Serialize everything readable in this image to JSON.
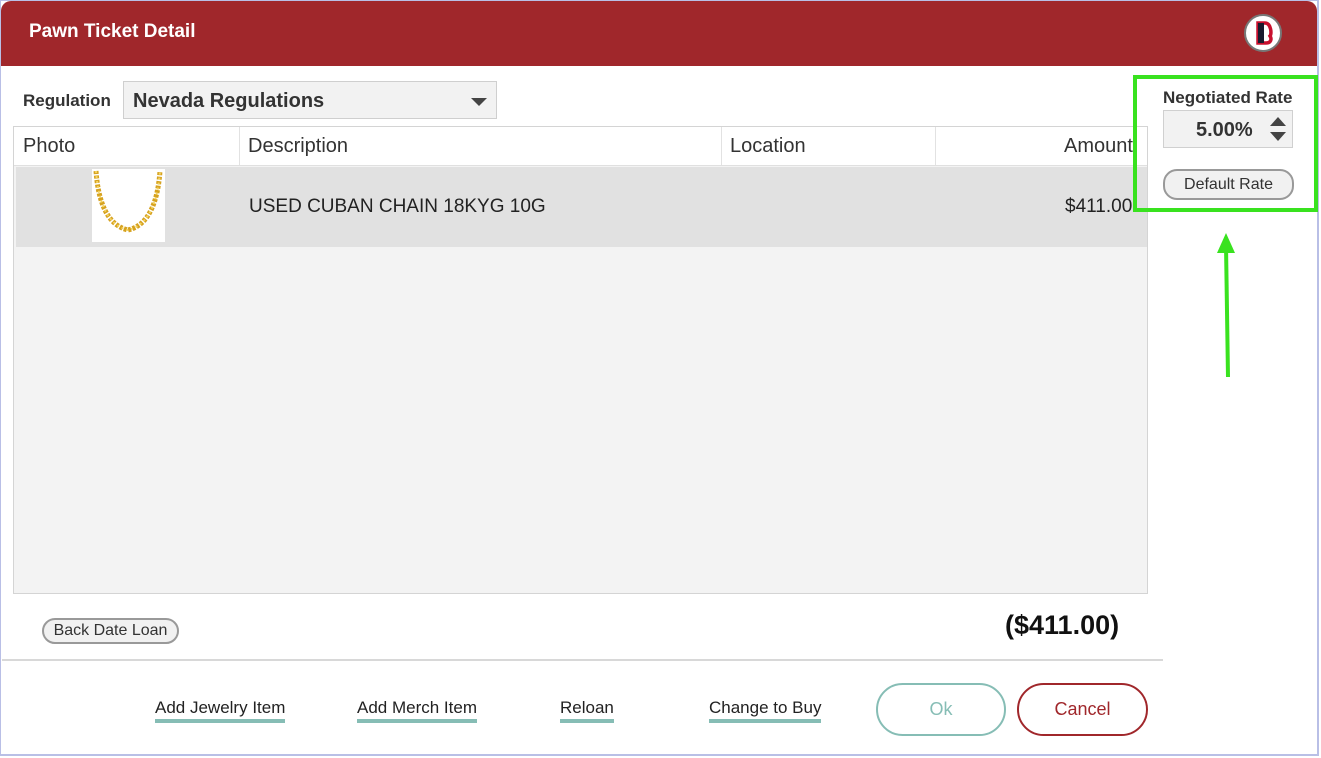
{
  "window": {
    "title": "Pawn Ticket Detail",
    "logo_icon": "brand-b-logo"
  },
  "regulation": {
    "label": "Regulation",
    "selected": "Nevada Regulations"
  },
  "grid": {
    "columns": [
      "Photo",
      "Description",
      "Location",
      "Amount"
    ],
    "rows": [
      {
        "photo_icon": "gold-chain-thumbnail",
        "description": "USED CUBAN CHAIN 18KYG 10G",
        "location": "",
        "amount": "$411.00"
      }
    ]
  },
  "back_date_label": "Back Date Loan",
  "total": "($411.00)",
  "footer": {
    "links": [
      "Add Jewelry Item",
      "Add Merch Item",
      "Reloan",
      "Change to Buy"
    ],
    "ok_label": "Ok",
    "cancel_label": "Cancel"
  },
  "rate": {
    "label": "Negotiated Rate",
    "value": "5.00%",
    "default_label": "Default Rate"
  },
  "colors": {
    "title_bar": "#a0272b",
    "accent_teal": "#86bdb5",
    "highlight_green": "#39e21f"
  }
}
